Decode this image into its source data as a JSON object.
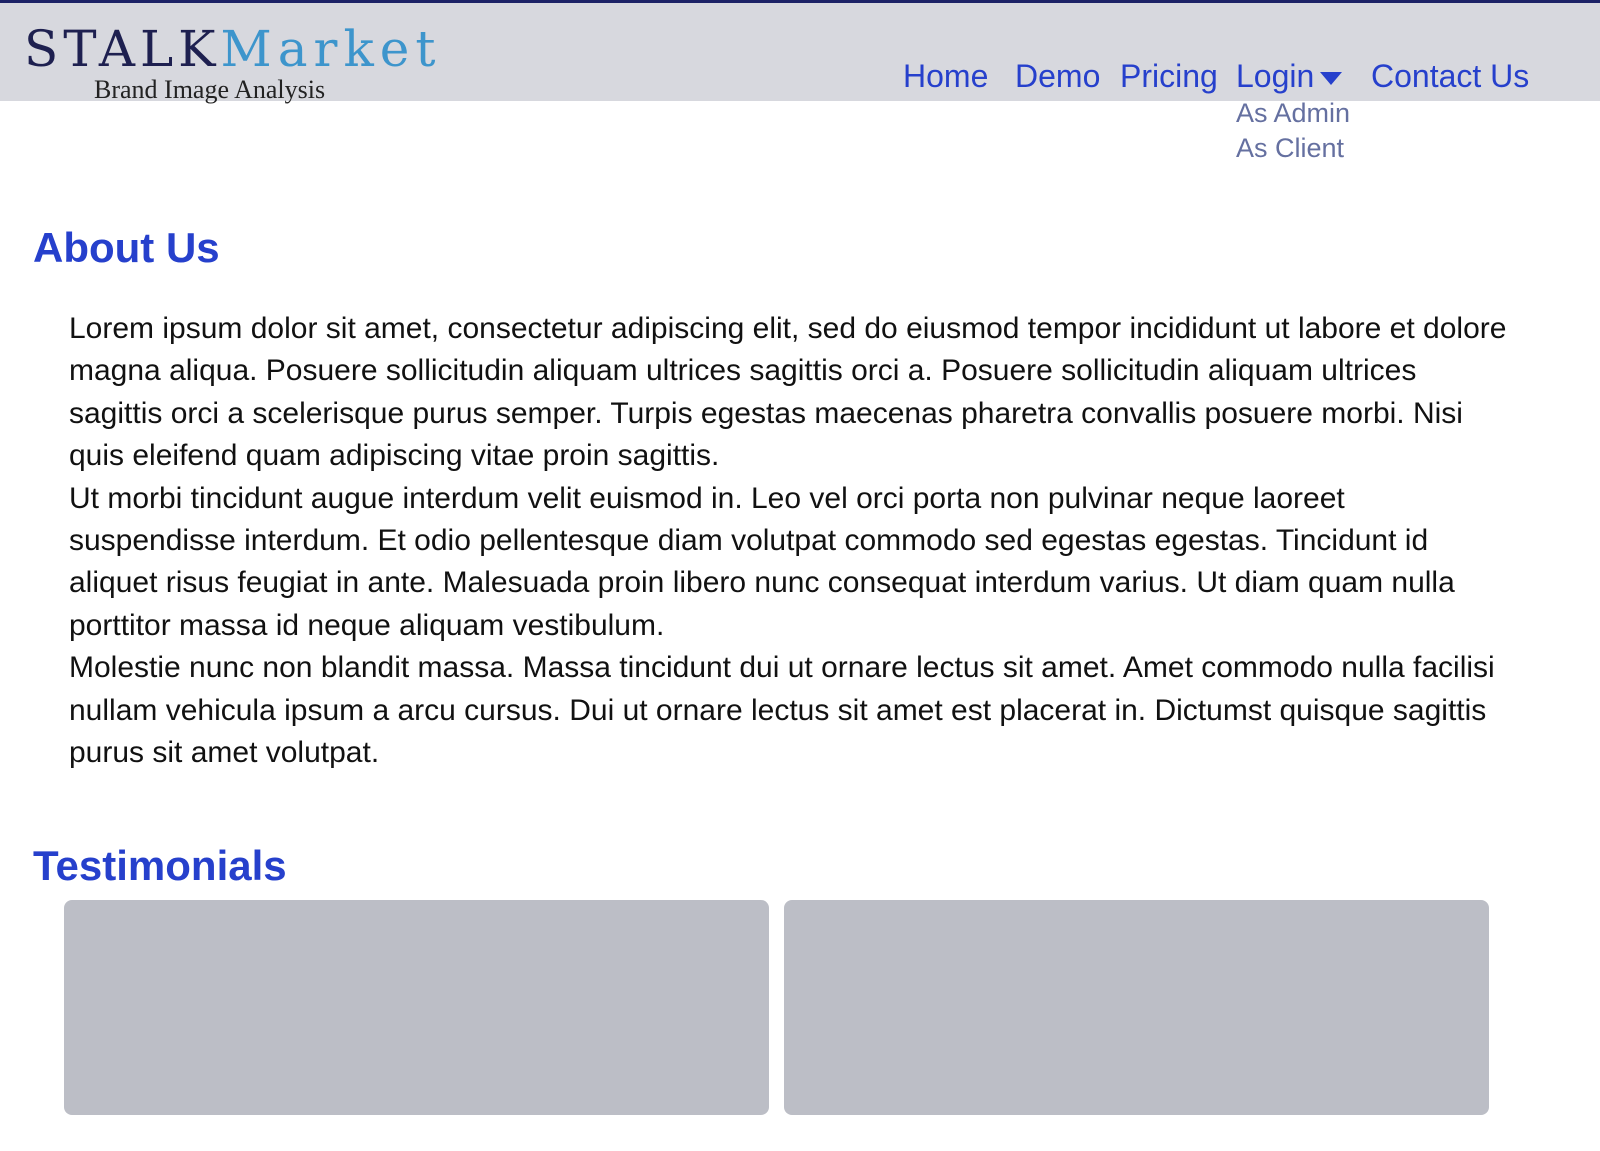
{
  "brand": {
    "name_part1": "STALK",
    "name_part2": "Market",
    "tagline": "Brand Image Analysis"
  },
  "nav": {
    "home": "Home",
    "demo": "Demo",
    "pricing": "Pricing",
    "login": "Login",
    "contact": "Contact Us",
    "login_menu": {
      "as_admin": "As Admin",
      "as_client": "As Client"
    }
  },
  "about": {
    "title": "About Us",
    "paragraphs": [
      "Lorem ipsum dolor sit amet, consectetur adipiscing elit, sed do eiusmod tempor incididunt ut labore et dolore magna aliqua. Posuere sollicitudin aliquam ultrices sagittis orci a. Posuere sollicitudin aliquam ultrices sagittis orci a scelerisque purus semper. Turpis egestas maecenas pharetra convallis posuere morbi. Nisi quis eleifend quam adipiscing vitae proin sagittis.",
      "Ut morbi tincidunt augue interdum velit euismod in. Leo vel orci porta non pulvinar neque laoreet suspendisse interdum. Et odio pellentesque diam volutpat commodo sed egestas egestas. Tincidunt id aliquet risus feugiat in ante. Malesuada proin libero nunc consequat interdum varius. Ut diam quam nulla porttitor massa id neque aliquam vestibulum.",
      "Molestie nunc non blandit massa. Massa tincidunt dui ut ornare lectus sit amet. Amet commodo nulla facilisi nullam vehicula ipsum a arcu cursus. Dui ut ornare lectus sit amet est placerat in. Dictumst quisque sagittis purus sit amet volutpat."
    ]
  },
  "testimonials": {
    "title": "Testimonials"
  },
  "colors": {
    "header_bg": "#d7d8de",
    "header_border": "#1c2266",
    "accent": "#2640cc",
    "logo_dark": "#1e2050",
    "logo_light": "#3d95cc",
    "dropdown_text": "#6570a0",
    "card_bg": "#bcbec6"
  },
  "icons": {
    "login_caret": "caret-down-icon"
  }
}
